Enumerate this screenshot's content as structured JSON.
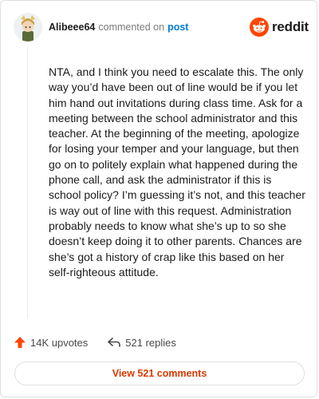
{
  "comment": {
    "username": "Alibeee64",
    "action_text": "commented on",
    "post_link": "post",
    "body": "NTA, and I think you need to escalate this. The only way you’d have been out of line would be if you let him hand out invitations during class time. Ask for a meeting between the school administrator and this teacher. At the beginning of the meeting, apologize for losing your temper and your language, but then go on to politely explain what happened during the phone call, and ask the administrator if this is school policy? I’m guessing it’s not, and this teacher is way out of line with this request. Administration probably needs to know what she’s up to so she doesn’t keep doing it to other parents. Chances are she’s got a history of crap like this based on her self-righteous attitude."
  },
  "brand": {
    "name": "reddit",
    "icon": "reddit-logo-icon",
    "color": "#ff4500"
  },
  "actions": {
    "upvotes_label": "14K upvotes",
    "upvote_icon": "upvote-arrow-icon",
    "replies_label": "521 replies",
    "reply_icon": "reply-arrow-icon"
  },
  "view_button": {
    "label": "View 521 comments"
  },
  "colors": {
    "accent": "#d93a00",
    "link": "#0079d3",
    "upvote": "#ff4500"
  }
}
